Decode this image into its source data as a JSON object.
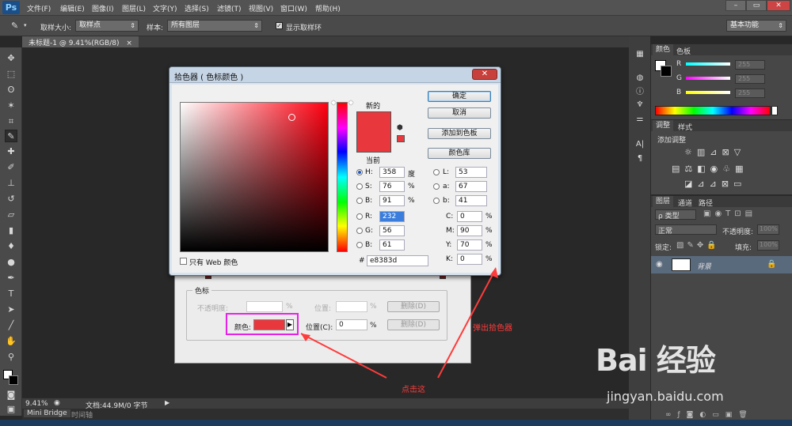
{
  "app": {
    "logo": "Ps",
    "menu": [
      "文件(F)",
      "编辑(E)",
      "图像(I)",
      "图层(L)",
      "文字(Y)",
      "选择(S)",
      "滤镜(T)",
      "视图(V)",
      "窗口(W)",
      "帮助(H)"
    ],
    "window_controls": [
      "–",
      "▭",
      "✕"
    ]
  },
  "options": {
    "sample_size_label": "取样大小:",
    "sample_size_value": "取样点",
    "sample_label": "样本:",
    "sample_value": "所有图层",
    "show_ring_label": "显示取样环",
    "workspace": "基本功能"
  },
  "document": {
    "tab": "未标题-1 @ 9.41%(RGB/8)",
    "zoom": "9.41%",
    "doc_info": "文档:44.9M/0 字节"
  },
  "bottom_tabs": [
    "Mini Bridge",
    "时间轴"
  ],
  "color_panel": {
    "tabs": [
      "颜色",
      "色板"
    ],
    "channels": [
      {
        "label": "R",
        "value": "255",
        "color": "#ff3030"
      },
      {
        "label": "G",
        "value": "255",
        "color": "#e030e0"
      },
      {
        "label": "B",
        "value": "255",
        "color": "#f0f030"
      }
    ]
  },
  "adjust_panel": {
    "tabs": [
      "调整",
      "样式"
    ],
    "add_label": "添加调整"
  },
  "layers_panel": {
    "tabs": [
      "图层",
      "通道",
      "路径"
    ],
    "filter_label": "ρ 类型",
    "blend_mode": "正常",
    "opacity_label": "不透明度:",
    "opacity_value": "100%",
    "lock_label": "锁定:",
    "fill_label": "填充:",
    "fill_value": "100%",
    "layer_name": "背景"
  },
  "gradient_dialog": {
    "section_title": "色标",
    "opacity_label": "不透明度:",
    "opacity_unit": "%",
    "position_label": "位置:",
    "position_unit": "%",
    "delete_label": "删除(D)",
    "color_label": "颜色:",
    "color_position_label": "位置(C):",
    "color_position_value": "0",
    "color_value": "#e8383d"
  },
  "color_picker": {
    "title": "拾色器 ( 色标颜色 )",
    "new_label": "新的",
    "current_label": "当前",
    "buttons": {
      "ok": "确定",
      "cancel": "取消",
      "add_swatch": "添加到色板",
      "library": "颜色库"
    },
    "hsb": [
      {
        "label": "H:",
        "value": "358",
        "unit": "度",
        "selected": true
      },
      {
        "label": "S:",
        "value": "76",
        "unit": "%"
      },
      {
        "label": "B:",
        "value": "91",
        "unit": "%"
      }
    ],
    "rgb": [
      {
        "label": "R:",
        "value": "232"
      },
      {
        "label": "G:",
        "value": "56"
      },
      {
        "label": "B:",
        "value": "61"
      }
    ],
    "lab": [
      {
        "label": "L:",
        "value": "53"
      },
      {
        "label": "a:",
        "value": "67"
      },
      {
        "label": "b:",
        "value": "41"
      }
    ],
    "cmyk": [
      {
        "label": "C:",
        "value": "0",
        "unit": "%"
      },
      {
        "label": "M:",
        "value": "90",
        "unit": "%"
      },
      {
        "label": "Y:",
        "value": "70",
        "unit": "%"
      },
      {
        "label": "K:",
        "value": "0",
        "unit": "%"
      }
    ],
    "hex_prefix": "#",
    "hex_value": "e8383d",
    "web_only_label": "只有 Web 颜色",
    "selected_color": "#e8383d"
  },
  "annotations": {
    "click_here": "点击这",
    "popup_picker": "弹出拾色器",
    "highlight_color": "#e622e6"
  },
  "watermark": {
    "logo": "Bai 经验",
    "url": "jingyan.baidu.com"
  }
}
